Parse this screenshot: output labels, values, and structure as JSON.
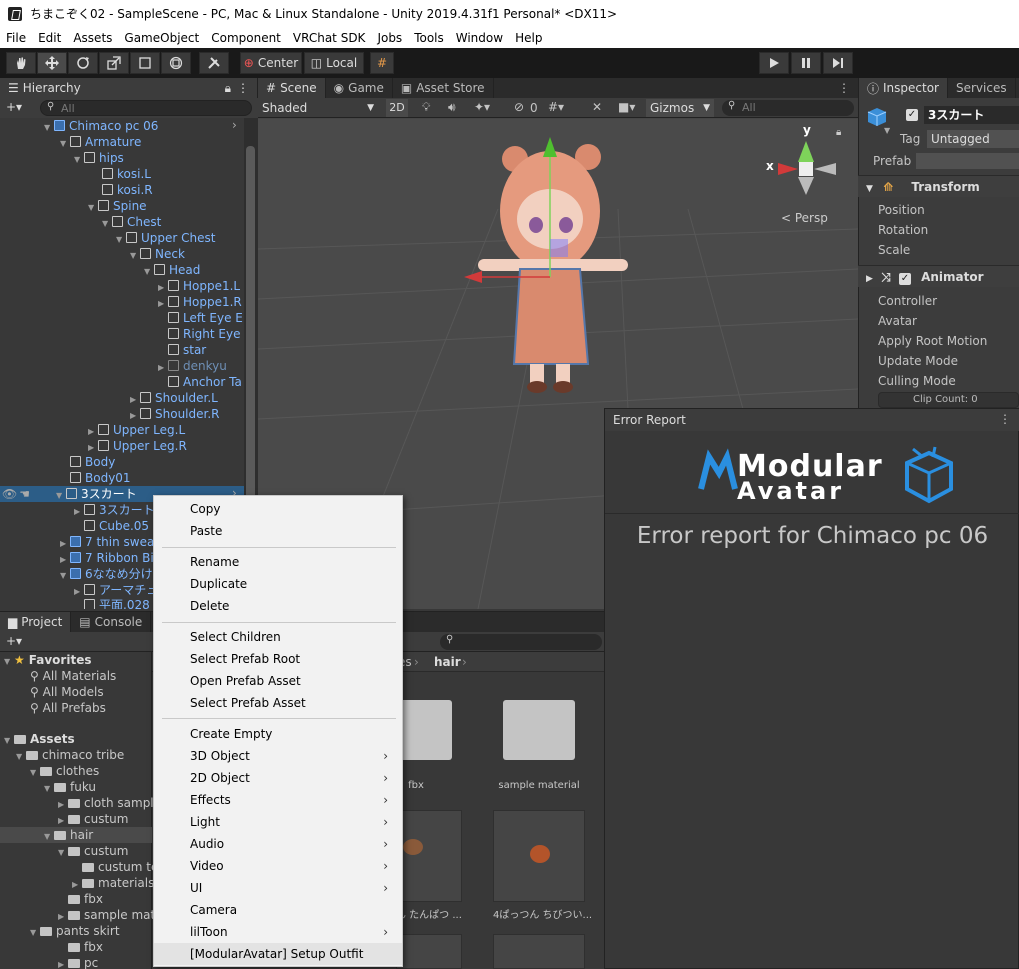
{
  "window": {
    "title": "ちまこぞく02 - SampleScene - PC, Mac & Linux Standalone - Unity 2019.4.31f1 Personal* <DX11>"
  },
  "menu": [
    "File",
    "Edit",
    "Assets",
    "GameObject",
    "Component",
    "VRChat SDK",
    "Jobs",
    "Tools",
    "Window",
    "Help"
  ],
  "toolbar": {
    "center_label": "Center",
    "local_label": "Local"
  },
  "hierarchy": {
    "tab": "Hierarchy",
    "search_placeholder": "All",
    "rows": [
      "Chimaco pc 06",
      "Armature",
      "hips",
      "kosi.L",
      "kosi.R",
      "Spine",
      "Chest",
      "Upper Chest",
      "Neck",
      "Head",
      "Hoppe1.L",
      "Hoppe1.R",
      "Left Eye E",
      "Right Eye",
      "star",
      "denkyu",
      "Anchor Ta",
      "Shoulder.L",
      "Shoulder.R",
      "Upper Leg.L",
      "Upper Leg.R",
      "Body",
      "Body01",
      "3スカート",
      "3スカート",
      "Cube.05",
      "7 thin swea",
      "7 Ribbon Bi",
      "6ななめ分け",
      "アーマチュ",
      "平面.028"
    ]
  },
  "scene": {
    "tabs": [
      "Scene",
      "Game",
      "Asset Store"
    ],
    "shading": "Shaded",
    "mode_2d": "2D",
    "hidden_count": "0",
    "gizmos": "Gizmos",
    "search_placeholder": "All",
    "axis_y": "y",
    "axis_x": "x",
    "persp": "< Persp"
  },
  "inspector": {
    "tabs": [
      "Inspector",
      "Services"
    ],
    "object_name": "3スカート",
    "tag_label": "Tag",
    "tag_value": "Untagged",
    "prefab_label": "Prefab",
    "transform": {
      "title": "Transform",
      "fields": [
        "Position",
        "Rotation",
        "Scale"
      ]
    },
    "animator": {
      "title": "Animator",
      "fields": [
        "Controller",
        "Avatar",
        "Apply Root Motion",
        "Update Mode",
        "Culling Mode"
      ],
      "clip_count": "Clip Count: 0"
    }
  },
  "error_report": {
    "tab": "Error Report",
    "logo_line1": "Modular",
    "logo_line2": "Avatar",
    "heading": "Error report for Chimaco pc 06"
  },
  "project": {
    "tabs": [
      "Project",
      "Console"
    ],
    "favorites_label": "Favorites",
    "favorites": [
      "All Materials",
      "All Models",
      "All Prefabs"
    ],
    "assets_label": "Assets",
    "tree": [
      "chimaco tribe",
      "clothes",
      "fuku",
      "cloth sampl",
      "custum",
      "hair",
      "custum",
      "custum te",
      "materials",
      "fbx",
      "sample mat",
      "pants skirt",
      "fbx",
      "pc"
    ],
    "breadcrumb": [
      "es",
      "hair"
    ],
    "grid": [
      "fbx",
      "sample material",
      "ん たんぱつ ...",
      "4ぱっつん ちびつい..."
    ]
  },
  "context_menu": {
    "items": [
      "Copy",
      "Paste",
      "Rename",
      "Duplicate",
      "Delete",
      "Select Children",
      "Select Prefab Root",
      "Open Prefab Asset",
      "Select Prefab Asset",
      "Create Empty",
      "3D Object",
      "2D Object",
      "Effects",
      "Light",
      "Audio",
      "Video",
      "UI",
      "Camera",
      "lilToon",
      "[ModularAvatar] Setup Outfit"
    ]
  },
  "colors": {
    "accent_blue": "#7fb6ff",
    "logo_blue": "#2a8fe0",
    "selection": "#2c5d87"
  }
}
